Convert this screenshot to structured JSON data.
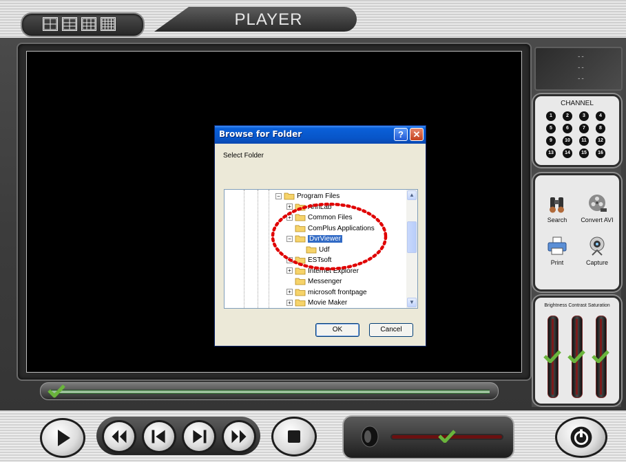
{
  "header": {
    "title": "PLAYER"
  },
  "layout_buttons": [
    "layout-1x1",
    "layout-2x2",
    "layout-3x3",
    "layout-4x4"
  ],
  "info": {
    "lines": [
      "--",
      "--",
      "--"
    ]
  },
  "channel": {
    "title": "CHANNEL",
    "numbers": [
      "1",
      "2",
      "3",
      "4",
      "5",
      "6",
      "7",
      "8",
      "9",
      "10",
      "11",
      "12",
      "13",
      "14",
      "15",
      "16"
    ]
  },
  "tools": {
    "search": "Search",
    "convert": "Convert AVI",
    "print": "Print",
    "capture": "Capture"
  },
  "adjust": {
    "title": "Brightness Contrast Saturation",
    "levels": [
      0.5,
      0.5,
      0.5
    ]
  },
  "seek": {
    "position": 0.0
  },
  "volume": {
    "level": 0.5
  },
  "dialog": {
    "title": "Browse for Folder",
    "help_glyph": "?",
    "close_glyph": "✕",
    "label": "Select Folder",
    "tree": [
      {
        "text": "Program Files",
        "expander": "⊟",
        "indent": 0,
        "selected": false
      },
      {
        "text": "AhnLab",
        "expander": "⊞",
        "indent": 1,
        "selected": false
      },
      {
        "text": "Common Files",
        "expander": "⊞",
        "indent": 1,
        "selected": false
      },
      {
        "text": "ComPlus Applications",
        "expander": "",
        "indent": 1,
        "selected": false
      },
      {
        "text": "DvrViewer",
        "expander": "⊟",
        "indent": 1,
        "selected": true
      },
      {
        "text": "Udf",
        "expander": "",
        "indent": 2,
        "selected": false
      },
      {
        "text": "ESTsoft",
        "expander": "⊞",
        "indent": 1,
        "selected": false
      },
      {
        "text": "Internet Explorer",
        "expander": "⊞",
        "indent": 1,
        "selected": false
      },
      {
        "text": "Messenger",
        "expander": "",
        "indent": 1,
        "selected": false
      },
      {
        "text": "microsoft frontpage",
        "expander": "⊞",
        "indent": 1,
        "selected": false
      },
      {
        "text": "Movie Maker",
        "expander": "⊞",
        "indent": 1,
        "selected": false
      }
    ],
    "ok": "OK",
    "cancel": "Cancel"
  },
  "colors": {
    "selection": "#316ac5",
    "annotation": "#e00000",
    "checkmark": "#6ab43c"
  }
}
